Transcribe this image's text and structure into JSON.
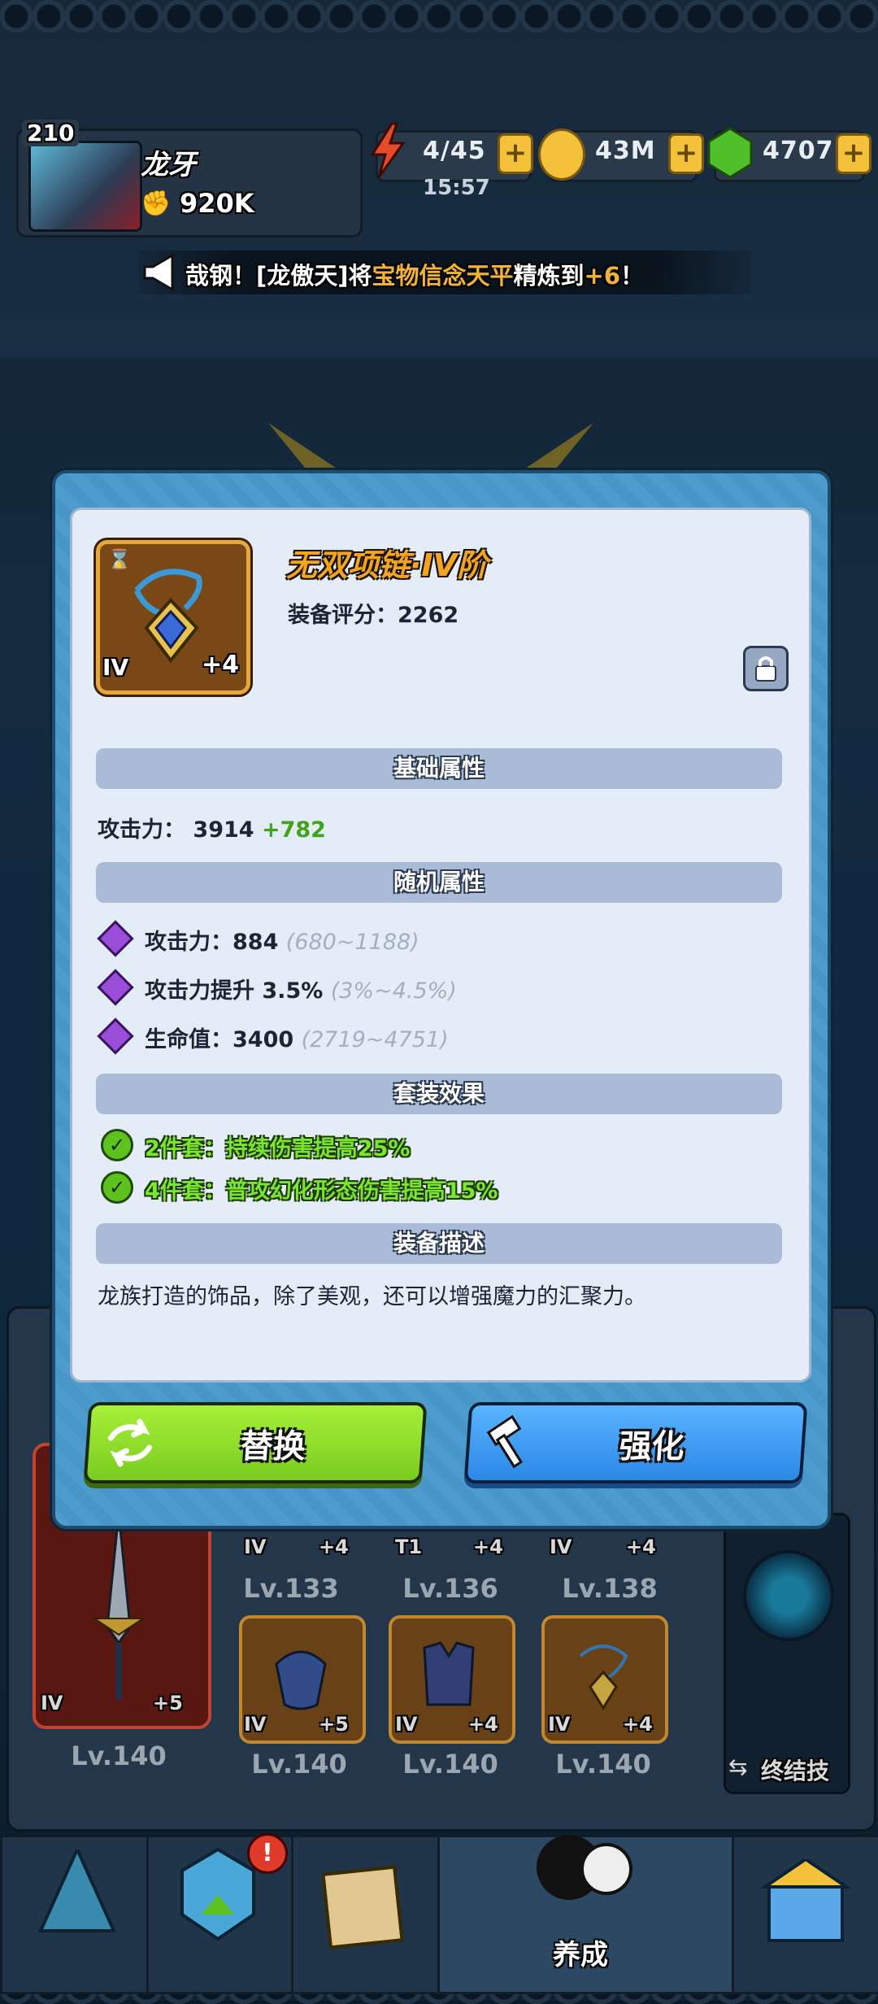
{
  "player": {
    "level": "210",
    "name": "龙牙",
    "power": "920K"
  },
  "resources": {
    "energy": "4/45",
    "timer": "15:57",
    "gold": "43M",
    "gems": "4707"
  },
  "broadcast": {
    "prefix": "哉钢！[龙傲天]将",
    "item": "宝物信念天平",
    "middle": "精炼到",
    "level": "+6",
    "suffix": "！"
  },
  "item": {
    "name": "无双项链·IV阶",
    "score": "装备评分：2262",
    "tier": "IV",
    "enhance": "+4"
  },
  "sections": {
    "base": "基础属性",
    "random": "随机属性",
    "set": "套装效果",
    "desc": "装备描述"
  },
  "base_stat": {
    "label": "攻击力：",
    "value": "3914",
    "bonus": "+782"
  },
  "random_stats": [
    {
      "label": "攻击力：884",
      "range": "(680~1188)"
    },
    {
      "label": "攻击力提升 3.5%",
      "range": "(3%~4.5%)"
    },
    {
      "label": "生命值：3400",
      "range": "(2719~4751)"
    }
  ],
  "set_effects": [
    "2件套：持续伤害提高25%",
    "4件套：普攻幻化形态伤害提高15%"
  ],
  "description": "龙族打造的饰品，除了美观，还可以增强魔力的汇聚力。",
  "buttons": {
    "replace": "替换",
    "enhance": "强化"
  },
  "equipment": {
    "weapon": {
      "tier": "IV",
      "enhance": "+5",
      "level": "Lv.140"
    },
    "row1": [
      {
        "tier": "IV",
        "enhance": "+4",
        "level": "Lv.133"
      },
      {
        "tier": "T1",
        "enhance": "+4",
        "level": "Lv.136"
      },
      {
        "tier": "IV",
        "enhance": "+4",
        "level": "Lv.138"
      }
    ],
    "row2": [
      {
        "tier": "IV",
        "enhance": "+5",
        "level": "Lv.140"
      },
      {
        "tier": "IV",
        "enhance": "+4",
        "level": "Lv.140"
      },
      {
        "tier": "IV",
        "enhance": "+4",
        "level": "Lv.140"
      }
    ],
    "ultimate": "终结技"
  },
  "nav": {
    "active_label": "养成"
  },
  "colors": {
    "accent_gold": "#f3a51f",
    "set_green": "#7ce52f",
    "replace_btn": "#8fe22b",
    "enhance_btn": "#3b9df3"
  }
}
